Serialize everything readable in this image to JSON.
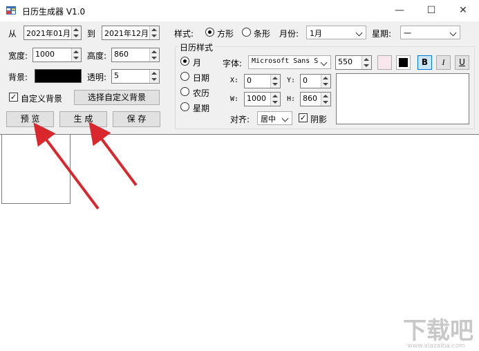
{
  "window": {
    "title": "日历生成器 V1.0",
    "minimize": "—",
    "maximize": "☐",
    "close": "✕"
  },
  "range": {
    "from_label": "从",
    "from_value": "2021年01月",
    "to_label": "到",
    "to_value": "2021年12月"
  },
  "style": {
    "label": "样式:",
    "option_square": "方形",
    "option_bar": "条形",
    "selected": "方形"
  },
  "month": {
    "label": "月份:",
    "value": "1月"
  },
  "week": {
    "label": "星期:",
    "value": "一"
  },
  "size": {
    "width_label": "宽度:",
    "width_value": "1000",
    "height_label": "高度:",
    "height_value": "860"
  },
  "background": {
    "label": "背景:",
    "color": "#000000",
    "opacity_label": "透明:",
    "opacity_value": "5",
    "custom_checkbox_label": "自定义背景",
    "custom_checked": true,
    "choose_button": "选择自定义背景"
  },
  "actions": {
    "preview": "预 览",
    "generate": "生 成",
    "save": "保 存"
  },
  "calendar_style": {
    "group_title": "日历样式",
    "options": [
      "月",
      "日期",
      "农历",
      "星期"
    ],
    "selected": "月"
  },
  "font": {
    "label": "字体:",
    "value": "Microsoft Sans S",
    "size_value": "550",
    "fore_color": "#f8e8ee",
    "back_color": "#000000",
    "bold": "B",
    "italic": "I",
    "underline": "U"
  },
  "position": {
    "x_label": "X:",
    "x_value": "0",
    "y_label": "Y:",
    "y_value": "0",
    "w_label": "W:",
    "w_value": "1000",
    "h_label": "H:",
    "h_value": "860"
  },
  "align": {
    "label": "对齐:",
    "value": "居中",
    "shadow_label": "阴影",
    "shadow_checked": true
  },
  "watermark": {
    "text": "下载吧",
    "url": "www.xiazaiba.com"
  }
}
